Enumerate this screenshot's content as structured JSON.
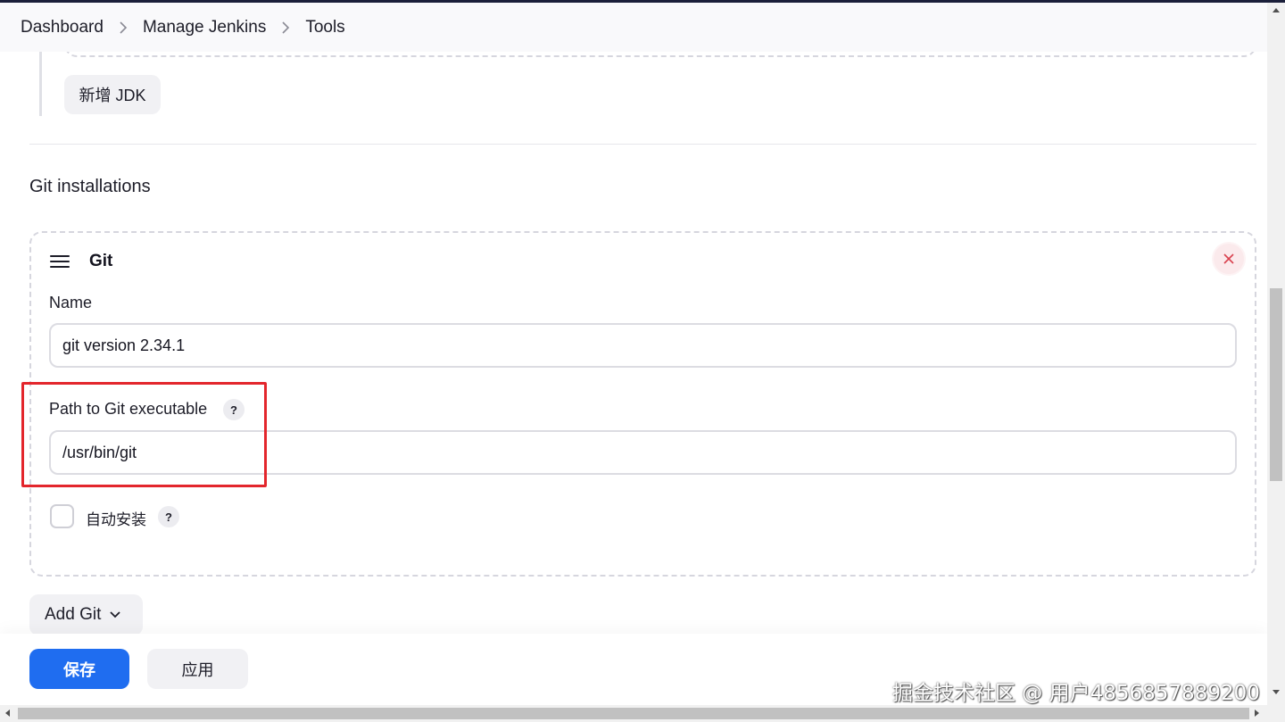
{
  "breadcrumb": {
    "items": [
      {
        "label": "Dashboard"
      },
      {
        "label": "Manage Jenkins"
      },
      {
        "label": "Tools"
      }
    ],
    "separator_icon": "chevron-right-icon"
  },
  "jdk": {
    "add_button_label": "新增 JDK"
  },
  "git_section": {
    "title": "Git installations",
    "card": {
      "title": "Git",
      "drag_icon": "hamburger-icon",
      "delete_icon": "close-icon",
      "name_label": "Name",
      "name_value": "git version 2.34.1",
      "path_label": "Path to Git executable",
      "path_value": "/usr/bin/git",
      "help_glyph": "?",
      "auto_install_label": "自动安装",
      "auto_install_checked": false
    },
    "add_button_label": "Add Git",
    "add_button_icon": "chevron-down-icon"
  },
  "actions": {
    "save_label": "保存",
    "apply_label": "应用"
  },
  "watermark": {
    "text": "掘金技术社区 @ 用户4856857889200"
  },
  "colors": {
    "primary": "#1f6df0",
    "highlight": "#e3262c",
    "danger_bg": "#fbeaec",
    "danger": "#d9424f"
  }
}
